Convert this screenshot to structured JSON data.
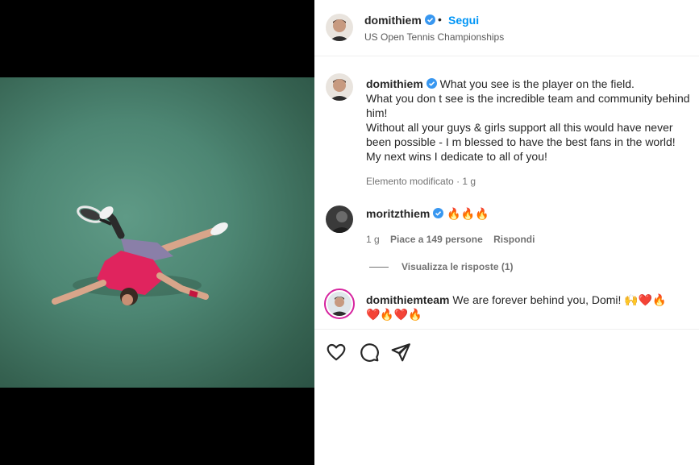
{
  "post": {
    "username": "domithiem",
    "separator": "•",
    "follow_label": "Segui",
    "location": "US Open Tennis Championships"
  },
  "caption": {
    "username": "domithiem",
    "lines": [
      "What you see is the player on the field.",
      "What you don t see is the incredible team and community behind him!",
      "Without all your guys & girls support all this would have never been possible - I m blessed to have the best fans in the world!",
      "My next wins I dedicate to all of you!"
    ],
    "edited_label": "Elemento modificato",
    "meta_separator": "·",
    "time_ago": "1 g"
  },
  "comments": [
    {
      "username": "moritzthiem",
      "text": "🔥🔥🔥",
      "time_ago": "1 g",
      "likes_label": "Piace a 149 persone",
      "reply_label": "Rispondi",
      "view_replies_label": "Visualizza le risposte (1)"
    },
    {
      "username": "domithiemteam",
      "text": "We are forever behind you, Domi! 🙌❤️🔥 ❤️🔥❤️🔥"
    }
  ],
  "icons": {
    "like": "heart-icon",
    "comment": "comment-icon",
    "share": "share-icon",
    "verified": "verified-badge-icon"
  },
  "colors": {
    "follow_blue": "#0095f6",
    "verified_blue": "#3897f0",
    "court_green": "#4d8673",
    "shirt_pink": "#e0245e"
  }
}
